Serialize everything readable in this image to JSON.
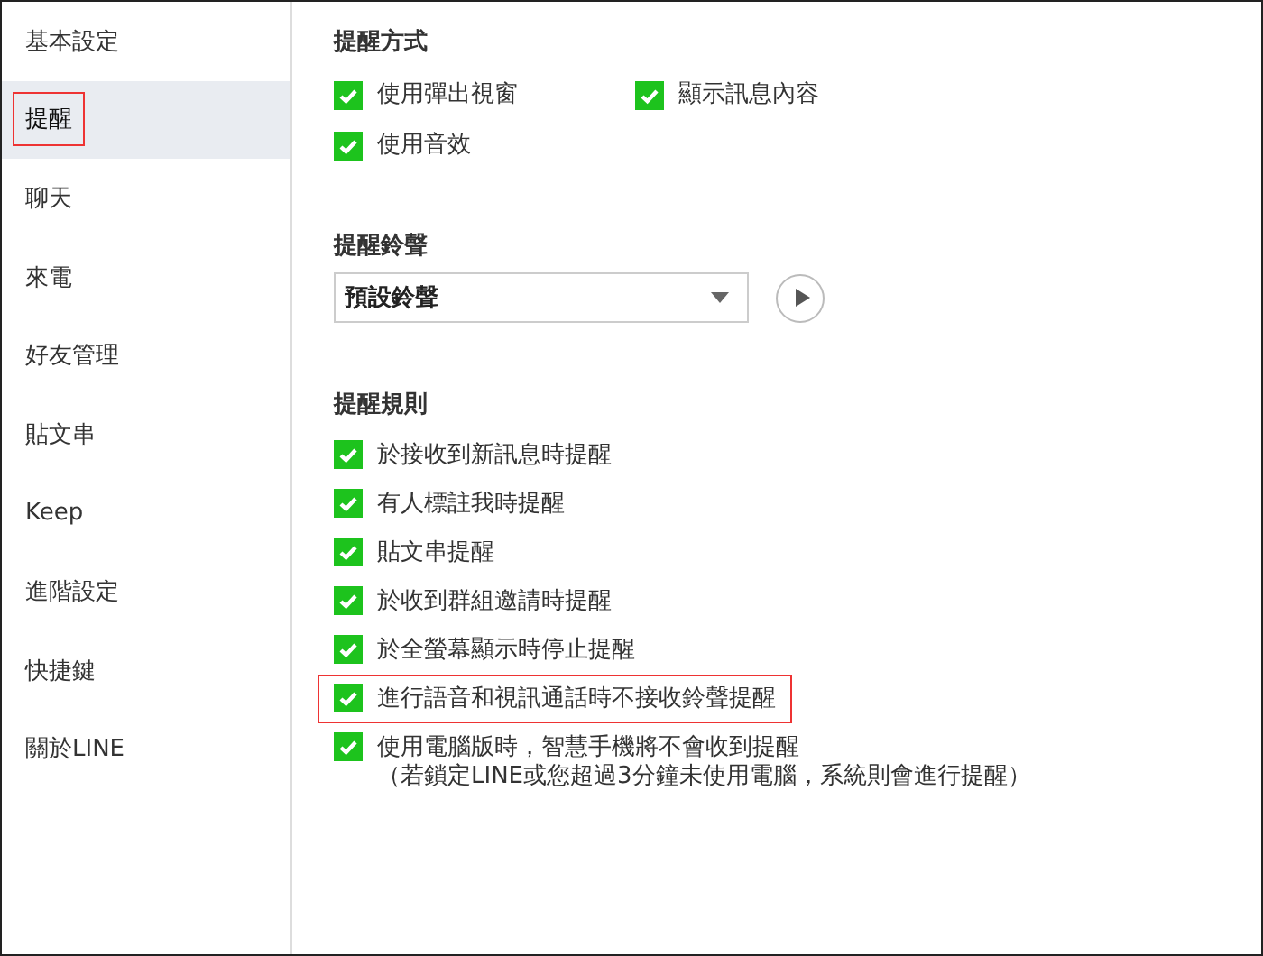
{
  "sidebar": {
    "items": [
      {
        "label": "基本設定",
        "selected": false,
        "highlighted": false
      },
      {
        "label": "提醒",
        "selected": true,
        "highlighted": true
      },
      {
        "label": "聊天",
        "selected": false,
        "highlighted": false
      },
      {
        "label": "來電",
        "selected": false,
        "highlighted": false
      },
      {
        "label": "好友管理",
        "selected": false,
        "highlighted": false
      },
      {
        "label": "貼文串",
        "selected": false,
        "highlighted": false
      },
      {
        "label": "Keep",
        "selected": false,
        "highlighted": false
      },
      {
        "label": "進階設定",
        "selected": false,
        "highlighted": false
      },
      {
        "label": "快捷鍵",
        "selected": false,
        "highlighted": false
      },
      {
        "label": "關於LINE",
        "selected": false,
        "highlighted": false
      }
    ]
  },
  "alert_method": {
    "title": "提醒方式",
    "options": [
      {
        "label": "使用彈出視窗",
        "checked": true
      },
      {
        "label": "顯示訊息內容",
        "checked": true
      },
      {
        "label": "使用音效",
        "checked": true
      }
    ]
  },
  "ringtone": {
    "title": "提醒鈴聲",
    "value": "預設鈴聲"
  },
  "rules": {
    "title": "提醒規則",
    "items": [
      {
        "label": "於接收到新訊息時提醒",
        "checked": true,
        "highlighted": false
      },
      {
        "label": "有人標註我時提醒",
        "checked": true,
        "highlighted": false
      },
      {
        "label": "貼文串提醒",
        "checked": true,
        "highlighted": false
      },
      {
        "label": "於收到群組邀請時提醒",
        "checked": true,
        "highlighted": false
      },
      {
        "label": "於全螢幕顯示時停止提醒",
        "checked": true,
        "highlighted": false
      },
      {
        "label": "進行語音和視訊通話時不接收鈴聲提醒",
        "checked": true,
        "highlighted": true
      },
      {
        "label": "使用電腦版時，智慧手機將不會收到提醒",
        "note": "（若鎖定LINE或您超過3分鐘未使用電腦，系統則會進行提醒）",
        "checked": true,
        "highlighted": false
      }
    ]
  }
}
